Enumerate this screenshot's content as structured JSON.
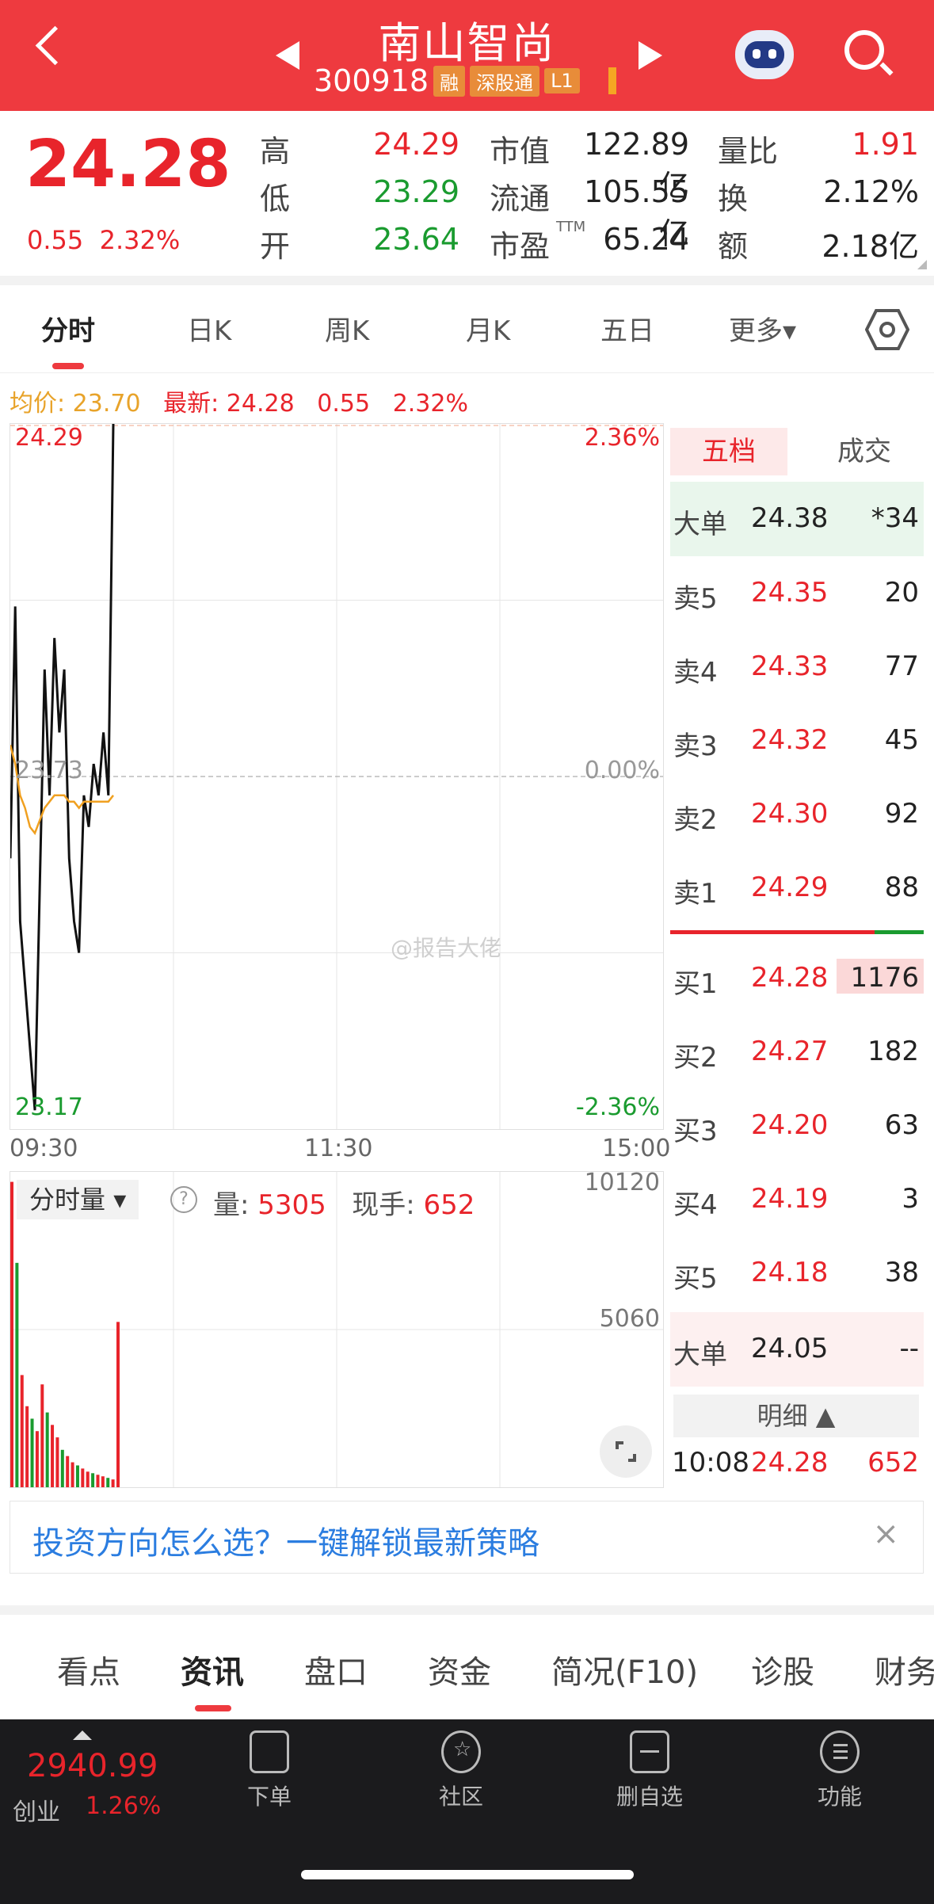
{
  "header": {
    "title": "南山智尚",
    "code": "300918",
    "tags": [
      "融",
      "深股通",
      "L1"
    ],
    "bg_color": "#ee3a3f"
  },
  "quote": {
    "price": "24.28",
    "change": "0.55",
    "change_pct": "2.32%",
    "high_label": "高",
    "high": "24.29",
    "low_label": "低",
    "low": "23.29",
    "open_label": "开",
    "open": "23.64",
    "mktcap_label": "市值",
    "mktcap": "122.89亿",
    "float_label": "流通",
    "float": "105.55亿",
    "pe_label": "市盈",
    "pe_sup": "TTM",
    "pe": "65.24",
    "volratio_label": "量比",
    "volratio": "1.91",
    "turnover_label": "换",
    "turnover": "2.12%",
    "amount_label": "额",
    "amount": "2.18亿"
  },
  "tabs": [
    "分时",
    "日K",
    "周K",
    "月K",
    "五日",
    "更多▾"
  ],
  "chart_info": {
    "avg_label": "均价: 23.70",
    "latest_label": "最新: 24.28",
    "latest_change": "0.55",
    "latest_pct": "2.32%"
  },
  "chart_data": {
    "type": "line",
    "title": "",
    "y_top": "24.29",
    "y_mid": "23.73",
    "y_bottom": "23.17",
    "pct_top": "2.36%",
    "pct_mid": "0.00%",
    "pct_bottom": "-2.36%",
    "x_labels": [
      "09:30",
      "11:30",
      "15:00"
    ],
    "ylim": [
      23.17,
      24.29
    ],
    "prev_close": 23.73,
    "series": [
      {
        "values": [
          23.6,
          24.0,
          23.5,
          23.4,
          23.3,
          23.2,
          23.55,
          23.9,
          23.7,
          23.95,
          23.8,
          23.9,
          23.6,
          23.5,
          23.45,
          23.7,
          23.65,
          23.75,
          23.7,
          23.8,
          23.7,
          24.29
        ]
      },
      {
        "values": [
          23.78,
          23.75,
          23.7,
          23.68,
          23.65,
          23.64,
          23.66,
          23.68,
          23.69,
          23.7,
          23.7,
          23.7,
          23.69,
          23.69,
          23.68,
          23.69,
          23.69,
          23.69,
          23.69,
          23.69,
          23.69,
          23.7
        ]
      }
    ]
  },
  "volume": {
    "label": "分时量",
    "help": "?",
    "vol_label": "量: ",
    "vol_value": "5305",
    "hand_label": "现手: ",
    "hand_value": "652",
    "y_top": "10120",
    "y_mid": "5060",
    "ylim": [
      0,
      10120
    ],
    "bars": [
      9800,
      7200,
      3600,
      2600,
      2200,
      1800,
      3300,
      2400,
      2000,
      1600,
      1200,
      1000,
      800,
      700,
      600,
      500,
      450,
      400,
      350,
      300,
      250,
      5305
    ]
  },
  "order_book": {
    "tab_active": "五档",
    "tab_other": "成交",
    "big_top_label": "大单",
    "big_top_price": "24.38",
    "big_top_vol": "*34",
    "asks": [
      {
        "name": "卖5",
        "price": "24.35",
        "vol": "20"
      },
      {
        "name": "卖4",
        "price": "24.33",
        "vol": "77"
      },
      {
        "name": "卖3",
        "price": "24.32",
        "vol": "45"
      },
      {
        "name": "卖2",
        "price": "24.30",
        "vol": "92"
      },
      {
        "name": "卖1",
        "price": "24.29",
        "vol": "88"
      }
    ],
    "bids": [
      {
        "name": "买1",
        "price": "24.28",
        "vol": "1176"
      },
      {
        "name": "买2",
        "price": "24.27",
        "vol": "182"
      },
      {
        "name": "买3",
        "price": "24.20",
        "vol": "63"
      },
      {
        "name": "买4",
        "price": "24.19",
        "vol": "3"
      },
      {
        "name": "买5",
        "price": "24.18",
        "vol": "38"
      }
    ],
    "big_bottom_label": "大单",
    "big_bottom_price": "24.05",
    "big_bottom_vol": "--",
    "detail_label": "明细 ▲",
    "tick_time": "10:08",
    "tick_price": "24.28",
    "tick_vol": "652"
  },
  "watermark": "@报告大佬",
  "banner": {
    "text": "投资方向怎么选？一键解锁最新策略",
    "close": "×"
  },
  "bottom_tabs": [
    "看点",
    "资讯",
    "盘口",
    "资金",
    "简况(F10)",
    "诊股",
    "财务"
  ],
  "dock": {
    "index_value": "2940.99",
    "index_name": "创业",
    "index_pct": "1.26%",
    "items": [
      "下单",
      "社区",
      "删自选",
      "功能"
    ]
  }
}
